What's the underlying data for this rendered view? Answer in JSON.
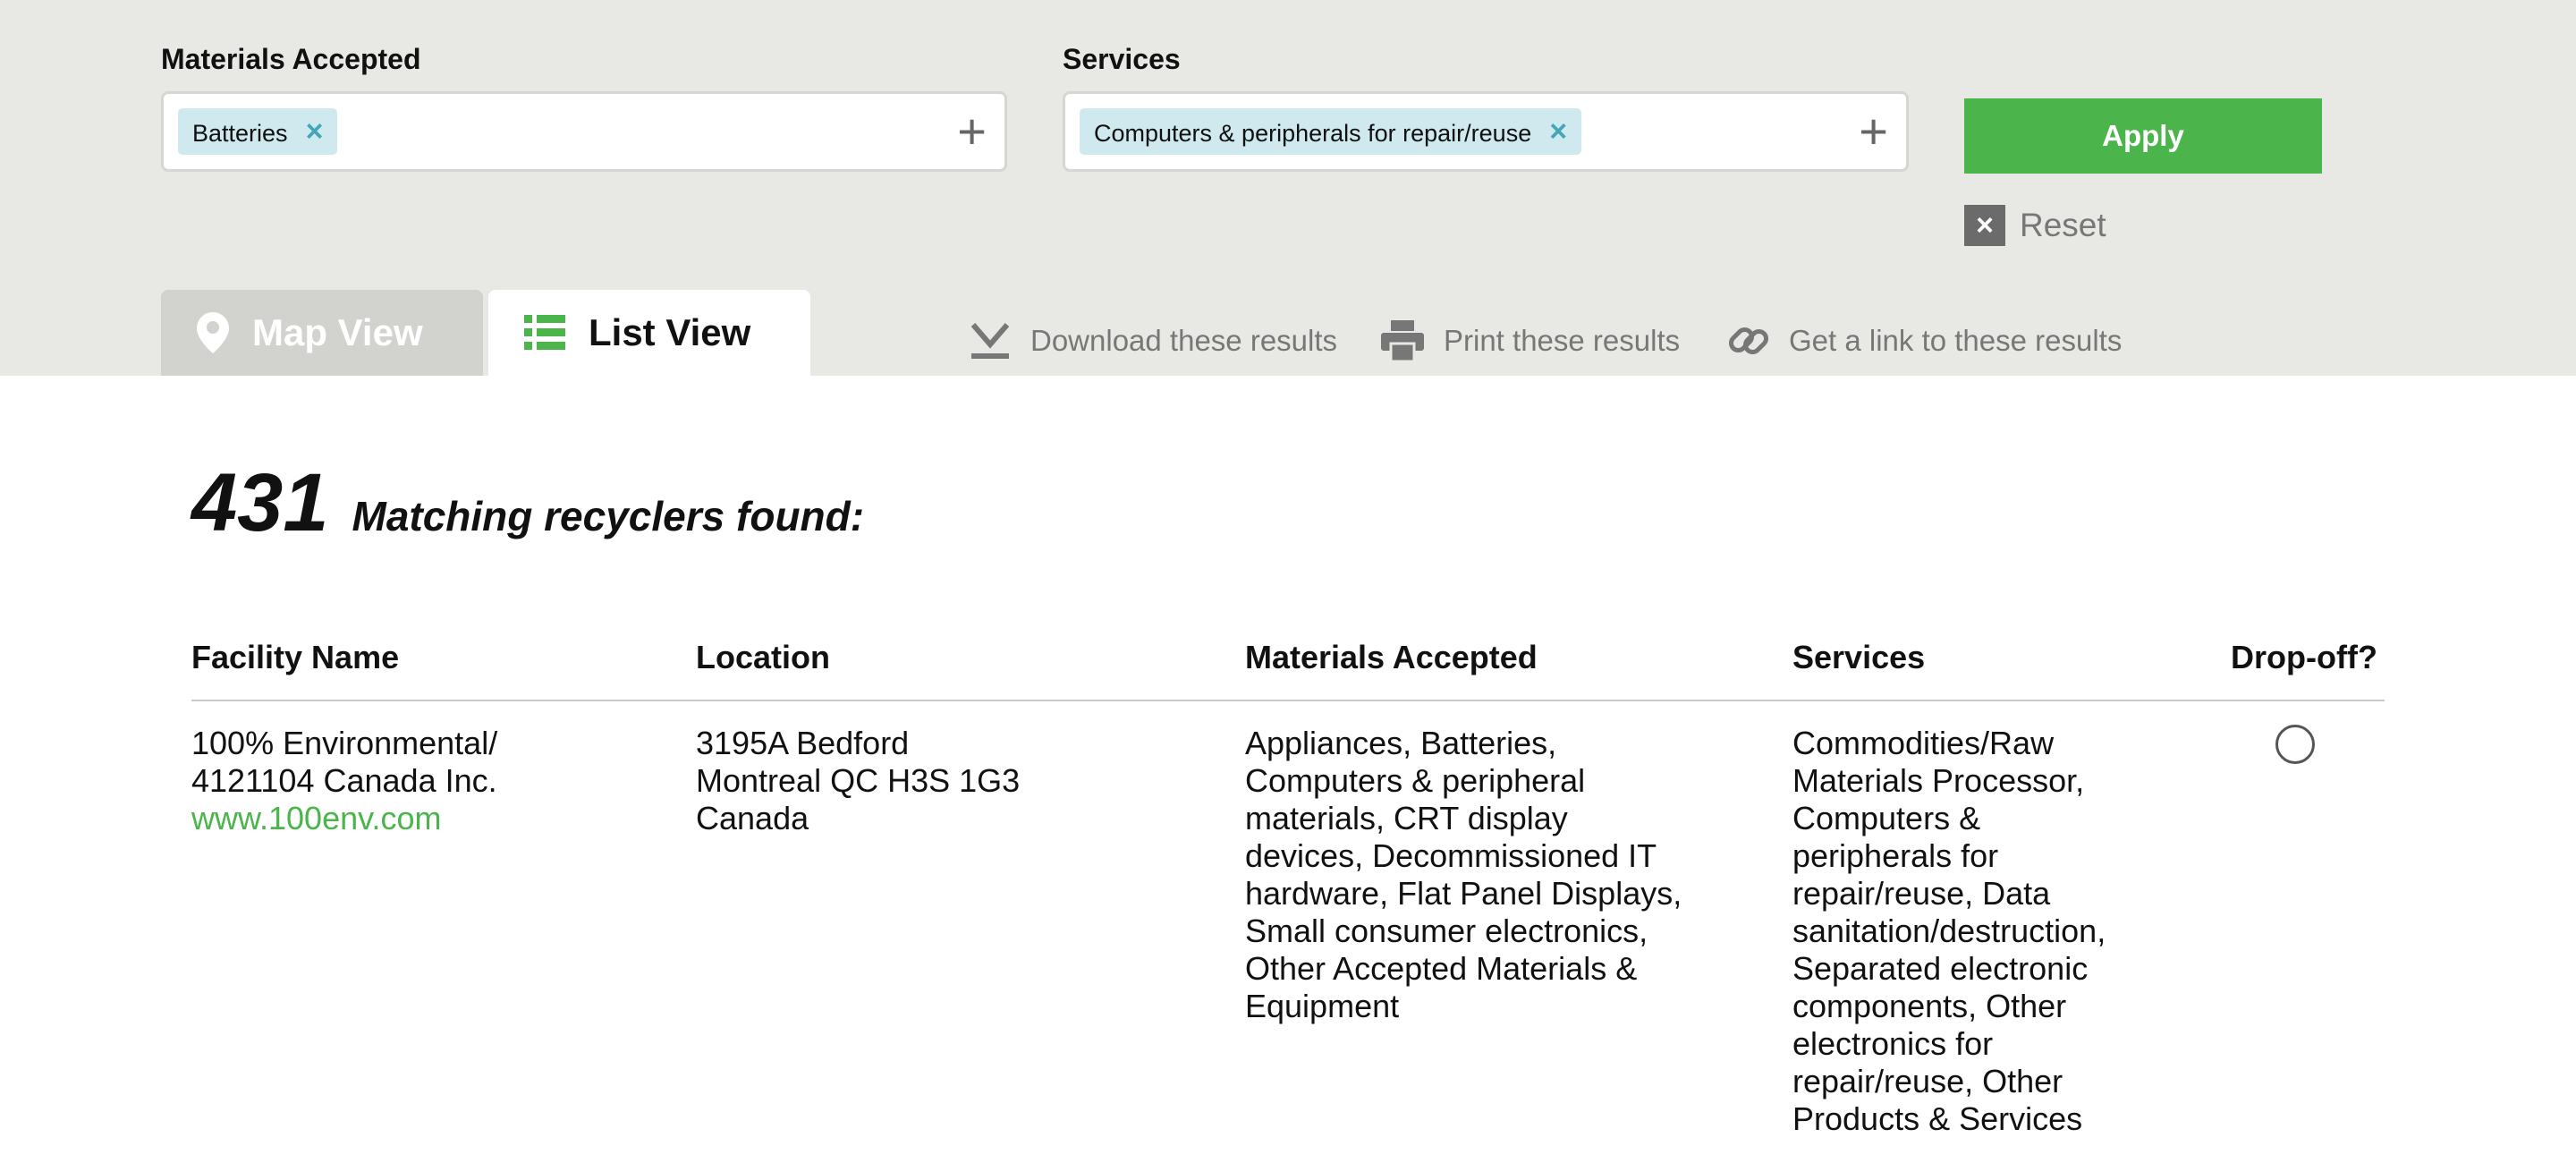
{
  "filters": {
    "materials": {
      "label": "Materials Accepted",
      "chips": [
        "Batteries"
      ]
    },
    "services": {
      "label": "Services",
      "chips": [
        "Computers & peripherals for repair/reuse"
      ]
    },
    "remove_glyph": "×",
    "add_glyph": "+"
  },
  "apply_label": "Apply",
  "reset": {
    "glyph": "×",
    "label": "Reset"
  },
  "tabs": {
    "map": "Map View",
    "list": "List View"
  },
  "actions": {
    "download": "Download these results",
    "print": "Print these results",
    "link": "Get a link to these results"
  },
  "results": {
    "count": "431",
    "label": "Matching recyclers found:"
  },
  "table": {
    "headers": [
      "Facility Name",
      "Location",
      "Materials Accepted",
      "Services",
      "Drop-off?"
    ],
    "rows": [
      {
        "name": "100% Environmental/ 4121104 Canada Inc.",
        "website": "www.100env.com",
        "location": [
          "3195A Bedford",
          "Montreal QC H3S 1G3",
          "Canada"
        ],
        "materials": "Appliances, Batteries, Computers & peripheral materials, CRT display devices, Decommissioned IT hardware, Flat Panel Displays, Small consumer electronics, Other Accepted Materials & Equipment",
        "services": "Commodities/Raw Materials Processor, Computers & peripherals for repair/reuse, Data sanitation/destruction, Separated electronic components, Other electronics for repair/reuse, Other Products & Services",
        "dropoff": false
      }
    ]
  },
  "colors": {
    "accent": "#4bb54b",
    "filter_bg": "#e8e8e4",
    "chip_bg": "#cfe9ef",
    "chip_x": "#45a6b8",
    "muted_text": "#777777"
  },
  "icons": {
    "map_tab": "map-pin-icon",
    "list_tab": "list-icon",
    "download": "download-icon",
    "print": "printer-icon",
    "link": "link-icon",
    "chip_remove": "close-icon",
    "add": "plus-icon",
    "reset": "close-icon"
  }
}
